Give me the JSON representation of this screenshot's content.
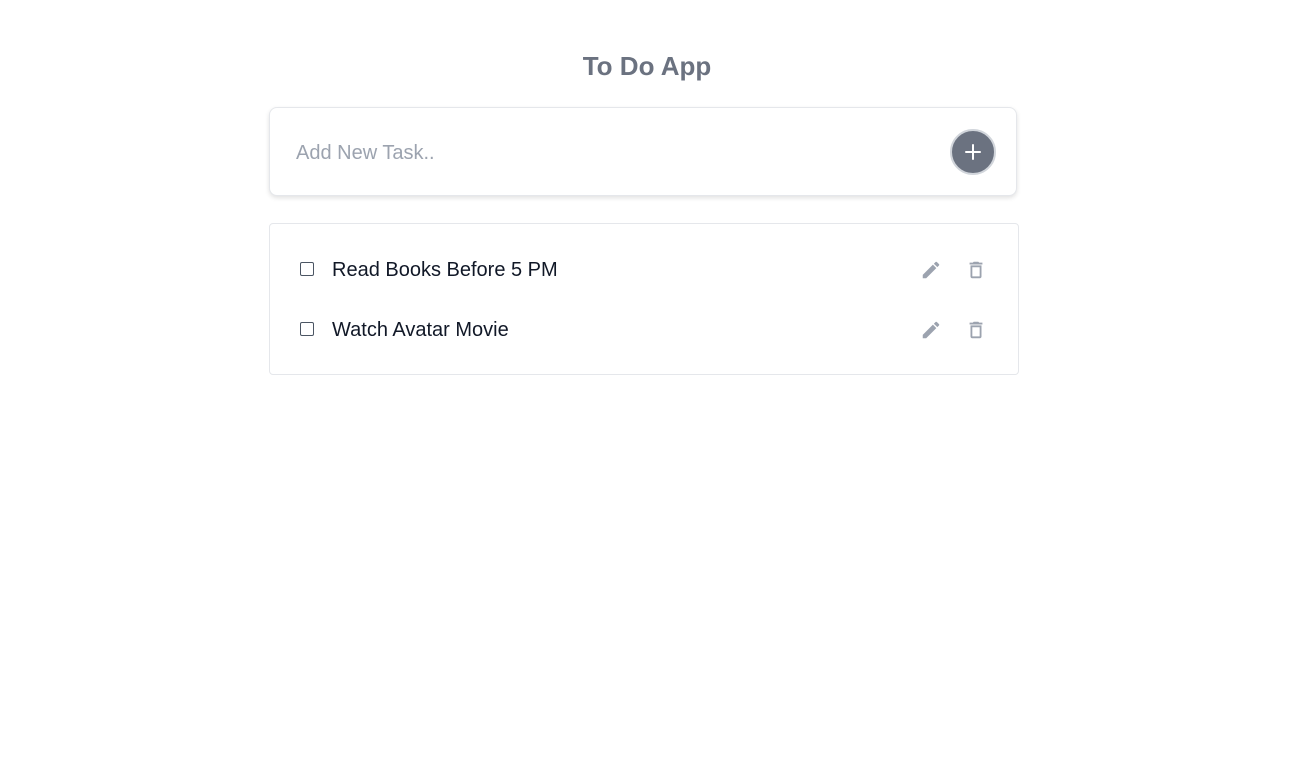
{
  "app": {
    "title": "To Do App"
  },
  "add_task": {
    "placeholder": "Add New Task..",
    "value": "",
    "button_icon": "plus-icon"
  },
  "tasks": [
    {
      "text": "Read Books Before 5 PM",
      "completed": false
    },
    {
      "text": "Watch Avatar Movie",
      "completed": false
    }
  ],
  "colors": {
    "title": "#6b7280",
    "add_button": "#6b7280",
    "icon": "#9ca3af",
    "task_text": "#111827"
  }
}
